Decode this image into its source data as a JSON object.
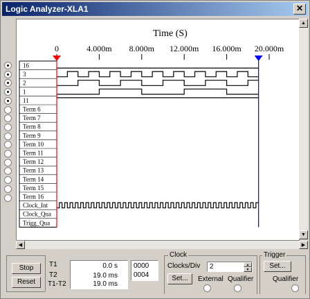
{
  "window": {
    "title": "Logic Analyzer-XLA1",
    "close_glyph": "✕"
  },
  "display": {
    "axis_title": "Time (S)",
    "ticks": [
      "0",
      "4.000m",
      "8.000m",
      "12.000m",
      "16.000m",
      "20.000m"
    ],
    "channels": [
      "16",
      "3",
      "2",
      "1",
      "11",
      "Term 6",
      "Term 7",
      "Term 8",
      "Term 9",
      "Term 10",
      "Term 11",
      "Term 12",
      "Term 13",
      "Term 14",
      "Term 15",
      "Term 16",
      "Clock_Int",
      "Clock_Qua",
      "Trigg_Qua"
    ],
    "cursor1_color": "#ff0000",
    "cursor2_color": "#0000ff"
  },
  "radios": {
    "count": 16,
    "filled_indices": [
      0,
      1,
      2,
      3,
      4
    ]
  },
  "controls": {
    "stop_label": "Stop",
    "reset_label": "Reset",
    "t1_label": "T1",
    "t2_label": "T2",
    "t1t2_label": "T1-T2",
    "t1_value": "0.0  s",
    "t2_value": "19.0 ms",
    "t1t2_value": "19.0 ms",
    "t1_hex": "0000",
    "t2_hex": "0004",
    "clock_group": "Clock",
    "clocks_per_div_label": "Clocks/Div",
    "clocks_per_div_value": "2",
    "clock_set_label": "Set...",
    "external_label": "External",
    "qualifier_label": "Qualifier",
    "trigger_group": "Trigger",
    "trigger_set_label": "Set...",
    "trigger_qualifier_label": "Qualifier"
  }
}
